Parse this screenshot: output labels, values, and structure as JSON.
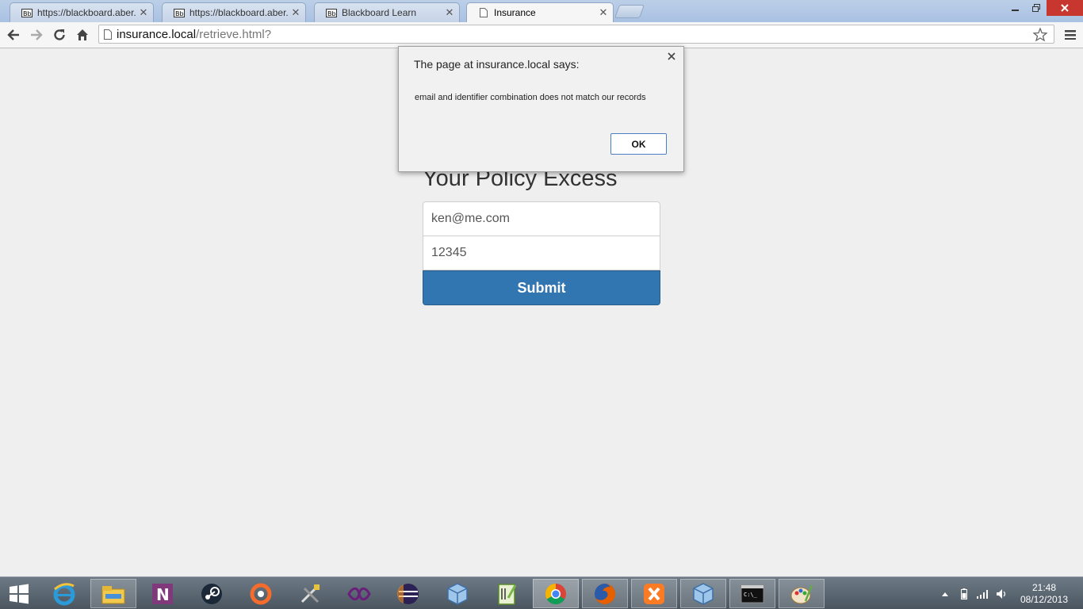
{
  "browser": {
    "tabs": [
      {
        "label": "https://blackboard.aber.ac",
        "active": false
      },
      {
        "label": "https://blackboard.aber.ac",
        "active": false
      },
      {
        "label": "Blackboard Learn",
        "active": false
      },
      {
        "label": "Insurance",
        "active": true
      }
    ],
    "address": {
      "host": "insurance.local",
      "path": "/retrieve.html?"
    }
  },
  "form": {
    "title": "Your Policy Excess",
    "email_value": "ken@me.com",
    "identifier_value": "12345",
    "submit_label": "Submit"
  },
  "dialog": {
    "title": "The page at insurance.local says:",
    "message": "email and identifier combination does not match our records",
    "ok_label": "OK"
  },
  "taskbar": {
    "apps": [
      "ie-icon",
      "file-explorer-icon",
      "onenote-icon",
      "steam-icon",
      "origin-icon",
      "tools-icon",
      "visual-studio-icon",
      "eclipse-icon",
      "virtualbox-icon",
      "notepad-plus-plus-icon",
      "chrome-icon",
      "firefox-icon",
      "xampp-icon",
      "virtualbox-vm-icon",
      "command-prompt-icon",
      "paint-icon"
    ],
    "time": "21:48",
    "date": "08/12/2013"
  },
  "colors": {
    "accent": "#3276b1",
    "close_button": "#c7372f"
  }
}
